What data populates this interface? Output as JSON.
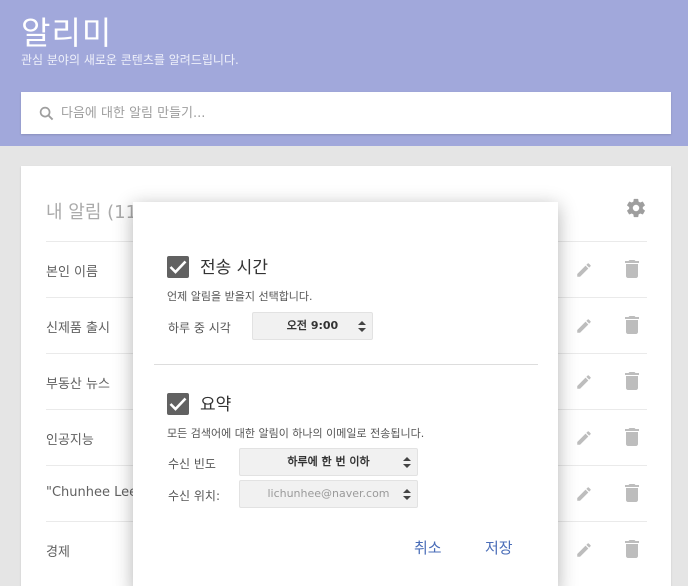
{
  "header": {
    "title": "알리미",
    "subtitle": "관심 분야의 새로운 콘텐츠를 알려드립니다."
  },
  "search": {
    "placeholder": "다음에 대한 알림 만들기..."
  },
  "alerts": {
    "title": "내 알림 (11)",
    "items": [
      {
        "label": "본인 이름"
      },
      {
        "label": "신제품 출시"
      },
      {
        "label": "부동산 뉴스"
      },
      {
        "label": "인공지능"
      },
      {
        "label": "\"Chunhee Lee\""
      },
      {
        "label": "경제"
      }
    ]
  },
  "dialog": {
    "delivery_time": {
      "checked": true,
      "title": "전송 시간",
      "description": "언제 알림을 받을지 선택합니다.",
      "field_label": "하루 중 시각",
      "value": "오전 9:00"
    },
    "digest": {
      "checked": true,
      "title": "요약",
      "description": "모든 검색어에 대한 알림이 하나의 이메일로 전송됩니다.",
      "frequency_label": "수신 빈도",
      "frequency_value": "하루에 한 번 이하",
      "deliver_to_label": "수신 위치:",
      "deliver_to_value": "lichunhee@naver.com"
    },
    "cancel_label": "취소",
    "save_label": "저장"
  },
  "colors": {
    "header": "#a1a8db",
    "accent": "#4a6db8"
  }
}
